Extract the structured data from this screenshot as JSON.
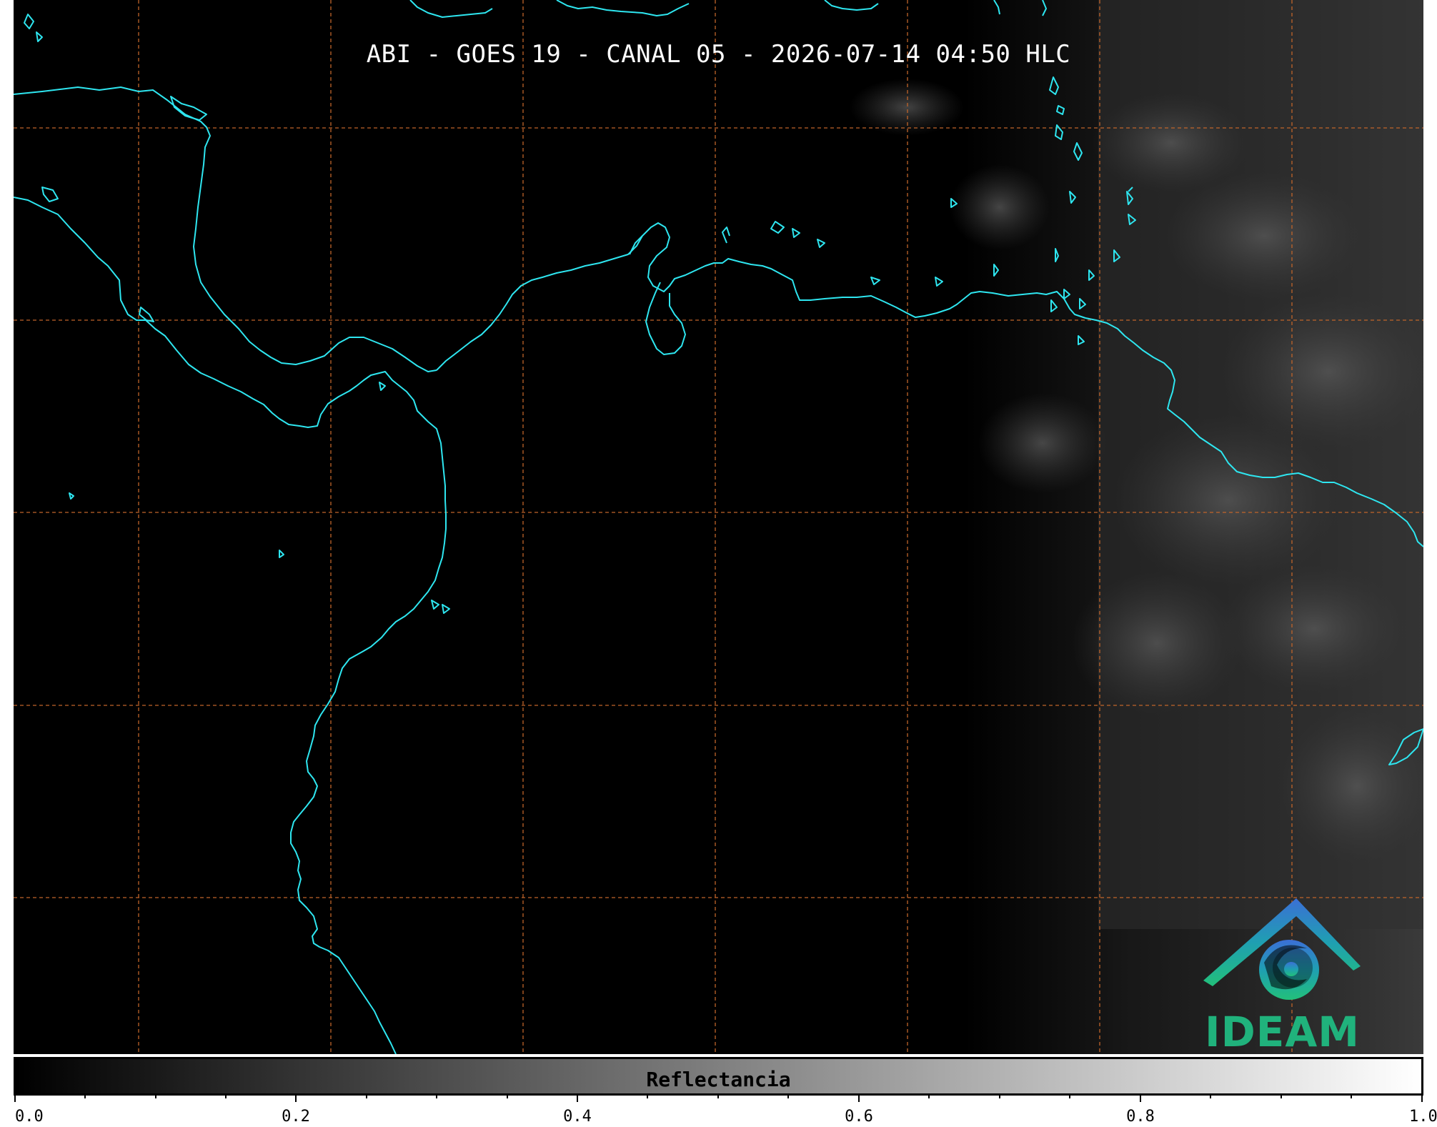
{
  "title": "ABI - GOES 19 - CANAL 05 - 2026-07-14 04:50 HLC",
  "colorbar": {
    "label": "Reflectancia",
    "range": [
      0.0,
      1.0
    ],
    "ticks": [
      "0.0",
      "0.2",
      "0.4",
      "0.6",
      "0.8",
      "1.0"
    ],
    "colormap": [
      "#000000",
      "#ffffff"
    ]
  },
  "logo": {
    "text": "IDEAM"
  },
  "map": {
    "gridlines": "dashed",
    "grid_color": "#c0642a",
    "coastline_color": "#2ee6f0",
    "background_color": "#000000"
  }
}
